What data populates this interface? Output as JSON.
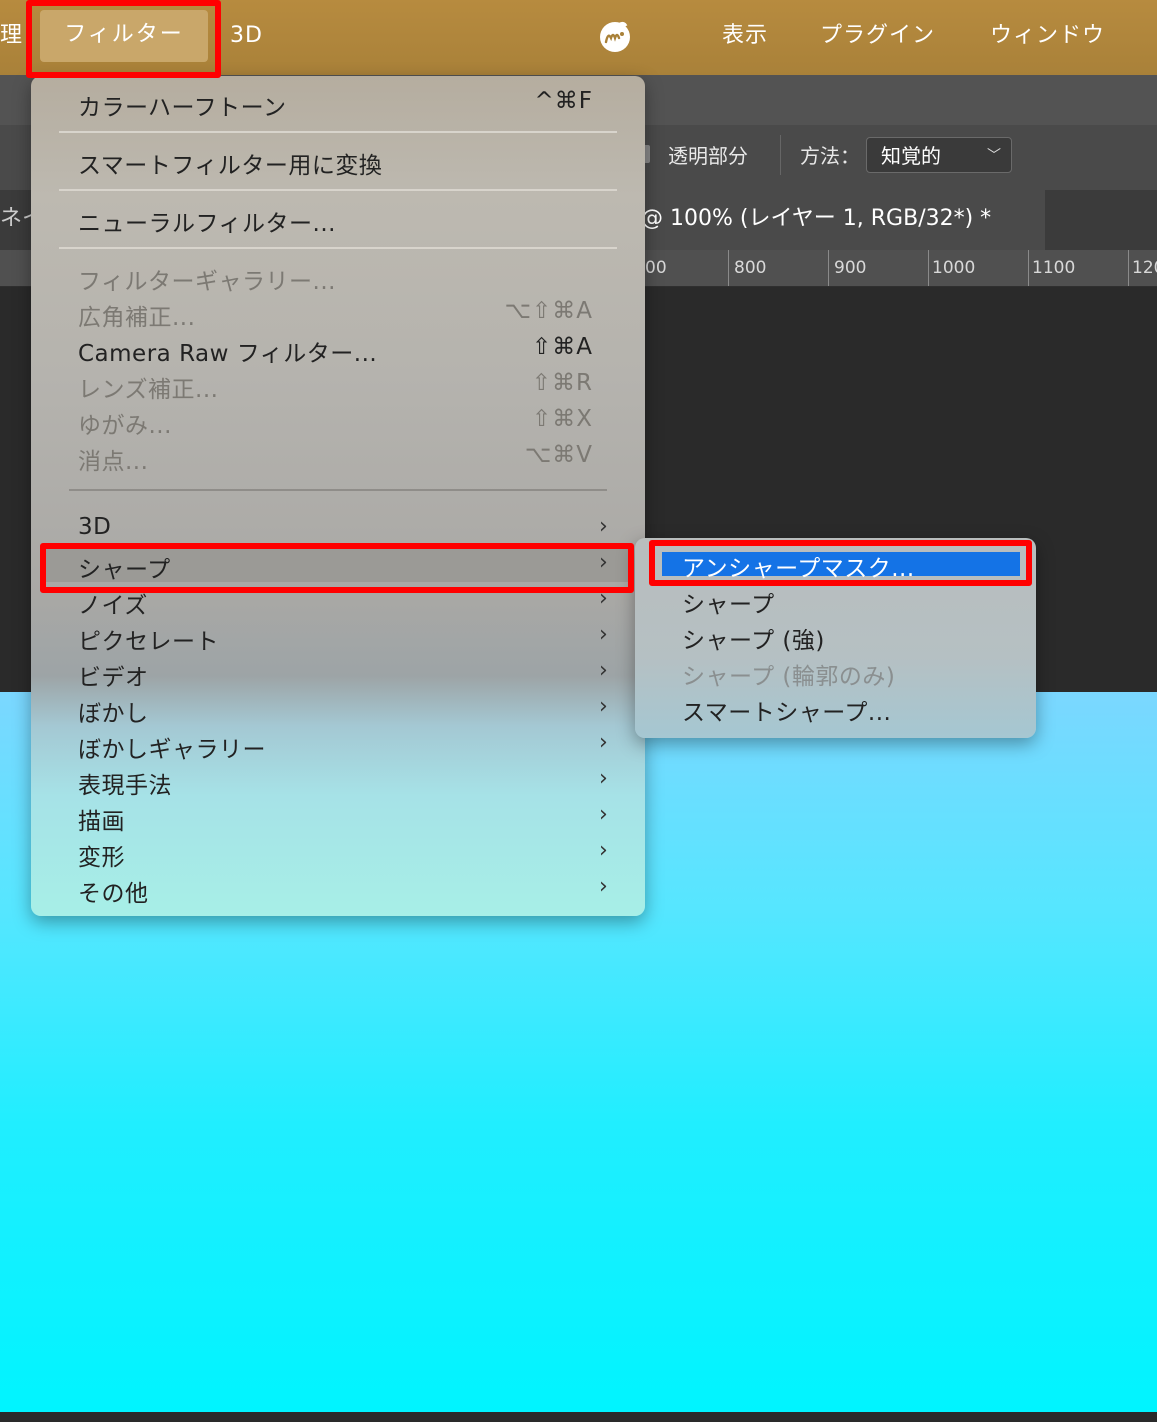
{
  "menubar": {
    "left_fragment": "理",
    "filter_label": "フィルター",
    "three_d_label": "3D",
    "logo_icon": "app-logo-icon",
    "view_label": "表示",
    "plugins_label": "プラグイン",
    "window_label": "ウィンドウ"
  },
  "options": {
    "transparency_label": "透明部分",
    "method_label": "方法：",
    "method_value": "知覚的"
  },
  "document": {
    "left_tab_fragment": "ネイ",
    "active_tab_title": "1 @ 100% (レイヤー 1, RGB/32*) *"
  },
  "ruler": {
    "labels": [
      "00",
      "800",
      "900",
      "1000",
      "1100",
      "120"
    ]
  },
  "menu": {
    "items": [
      {
        "label": "カラーハーフトーン",
        "shortcut": "^⌘F"
      },
      {
        "label": "スマートフィルター用に変換",
        "shortcut": ""
      },
      {
        "label": "ニューラルフィルター...",
        "shortcut": ""
      },
      {
        "label": "フィルターギャラリー...",
        "shortcut": ""
      },
      {
        "label": "広角補正...",
        "shortcut": "⌥⇧⌘A"
      },
      {
        "label": "Camera Raw フィルター...",
        "shortcut": "⇧⌘A"
      },
      {
        "label": "レンズ補正...",
        "shortcut": "⇧⌘R"
      },
      {
        "label": "ゆがみ...",
        "shortcut": "⇧⌘X"
      },
      {
        "label": "消点...",
        "shortcut": "⌥⌘V"
      },
      {
        "label": "3D",
        "shortcut": ""
      },
      {
        "label": "シャープ",
        "shortcut": ""
      },
      {
        "label": "ノイズ",
        "shortcut": ""
      },
      {
        "label": "ピクセレート",
        "shortcut": ""
      },
      {
        "label": "ビデオ",
        "shortcut": ""
      },
      {
        "label": "ぼかし",
        "shortcut": ""
      },
      {
        "label": "ぼかしギャラリー",
        "shortcut": ""
      },
      {
        "label": "表現手法",
        "shortcut": ""
      },
      {
        "label": "描画",
        "shortcut": ""
      },
      {
        "label": "変形",
        "shortcut": ""
      },
      {
        "label": "その他",
        "shortcut": ""
      }
    ],
    "submenu_arrow": "›"
  },
  "submenu": {
    "items": [
      {
        "label": "アンシャープマスク..."
      },
      {
        "label": "シャープ"
      },
      {
        "label": "シャープ (強)"
      },
      {
        "label": "シャープ (輪郭のみ)"
      },
      {
        "label": "スマートシャープ..."
      }
    ]
  },
  "colors": {
    "menubar": "#b78b3f",
    "highlight_blue": "#1473e6",
    "annotation_red": "#ff0000",
    "canvas_cyan": "#00f4ff"
  }
}
